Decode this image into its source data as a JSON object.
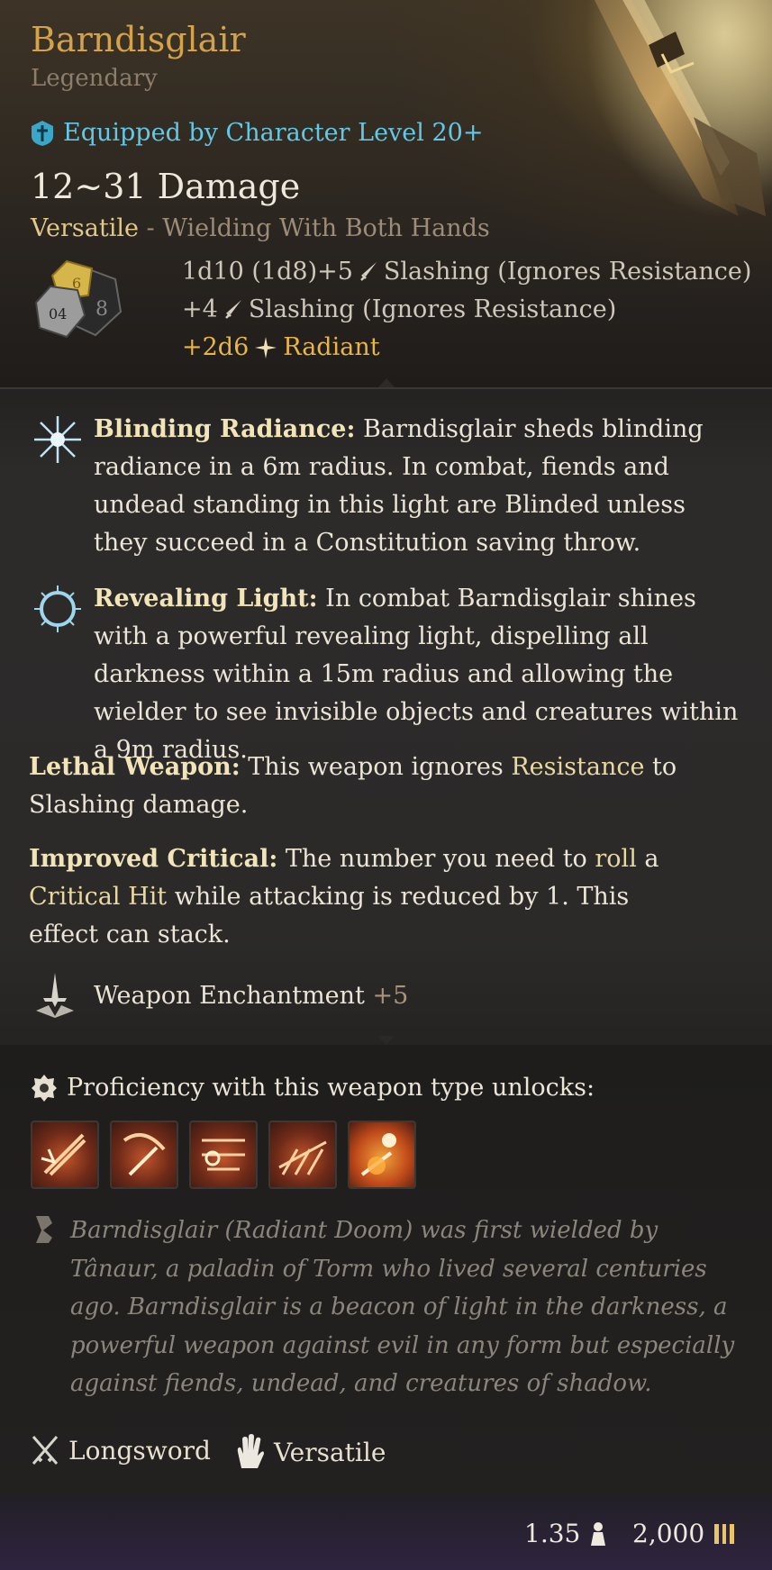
{
  "item": {
    "name": "Barndisglair",
    "rarity": "Legendary",
    "requirement": "Equipped by Character Level 20+",
    "damage": "12~31 Damage",
    "versatile_label": "Versatile",
    "versatile_detail": " - Wielding With Both Hands",
    "damage_lines": [
      {
        "dice": "1d10 (1d8)+5",
        "type": "Slashing (Ignores Resistance)",
        "icon": "dagger-icon"
      },
      {
        "dice": "+4",
        "type": "Slashing (Ignores Resistance)",
        "icon": "dagger-icon"
      },
      {
        "dice": "+2d6",
        "type": "Radiant",
        "icon": "radiant-star-icon"
      }
    ]
  },
  "passives": [
    {
      "name": "Blinding Radiance:",
      "text": " Barndisglair sheds blinding radiance in a 6m radius. In combat, fiends and undead standing in this light are Blinded unless they succeed in a Constitution saving throw.",
      "icon": "starburst-icon"
    },
    {
      "name": "Revealing Light:",
      "text": " In combat Barndisglair shines with a powerful revealing light, dispelling all darkness within a 15m radius and allowing the wielder to see invisible objects and creatures within a 9m radius.",
      "icon": "halo-burst-icon"
    }
  ],
  "lethal": {
    "name": "Lethal Weapon:",
    "pre": " This weapon ignores ",
    "kw": "Resistance",
    "post": " to Slashing damage."
  },
  "critical": {
    "name": "Improved Critical:",
    "pre": " The number you need to ",
    "kw1": "roll",
    "mid": " a ",
    "kw2": "Critical Hit",
    "post": " while attacking is reduced by 1. This effect can stack."
  },
  "enchantment": {
    "label": "Weapon Enchantment",
    "value": "+5"
  },
  "proficiency": {
    "label": "Proficiency with this weapon type unlocks:",
    "actions": [
      "action-1",
      "action-2",
      "action-3",
      "action-4",
      "action-5"
    ]
  },
  "lore": "Barndisglair (Radiant Doom) was first wielded by Tânaur, a paladin of Torm who lived several centuries ago.  Barndisglair is a beacon of light in the darkness, a powerful weapon against evil in any form but especially against fiends, undead, and creatures of shadow.",
  "tags": [
    {
      "label": "Longsword",
      "icon": "crossed-swords-icon"
    },
    {
      "label": "Versatile",
      "icon": "hand-icon"
    }
  ],
  "weight": "1.35",
  "price": "2,000",
  "colors": {
    "title": "#d4a24a",
    "requirement": "#63c8e6",
    "gold": "#e9b646"
  }
}
